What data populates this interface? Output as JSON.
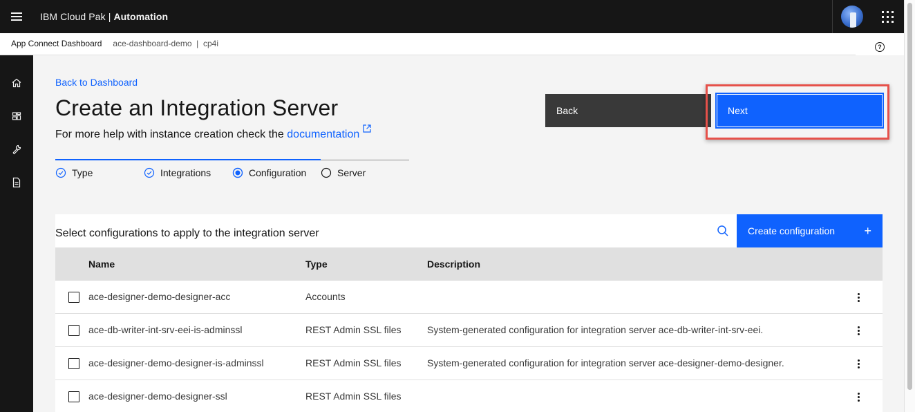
{
  "header": {
    "brand": "IBM Cloud Pak",
    "separator": "|",
    "product": "Automation"
  },
  "breadcrumb": {
    "app": "App Connect Dashboard",
    "instance": "ace-dashboard-demo",
    "divider": "|",
    "namespace": "cp4i"
  },
  "nav": {
    "items": [
      "home-icon",
      "dashboard-icon",
      "tools-icon",
      "document-icon"
    ]
  },
  "page": {
    "back_link": "Back to Dashboard",
    "title": "Create an Integration Server",
    "help_prefix": "For more help with instance creation check the ",
    "help_link": "documentation"
  },
  "actions": {
    "back_label": "Back",
    "next_label": "Next"
  },
  "progress": {
    "steps": [
      {
        "label": "Type",
        "state": "complete"
      },
      {
        "label": "Integrations",
        "state": "complete"
      },
      {
        "label": "Configuration",
        "state": "current"
      },
      {
        "label": "Server",
        "state": "incomplete"
      }
    ]
  },
  "table": {
    "title": "Select configurations to apply to the integration server",
    "create_label": "Create configuration",
    "create_icon": "+",
    "columns": [
      "Name",
      "Type",
      "Description"
    ],
    "rows": [
      {
        "name": "ace-designer-demo-designer-acc",
        "type": "Accounts",
        "description": ""
      },
      {
        "name": "ace-db-writer-int-srv-eei-is-adminssl",
        "type": "REST Admin SSL files",
        "description": "System-generated configuration for integration server ace-db-writer-int-srv-eei."
      },
      {
        "name": "ace-designer-demo-designer-is-adminssl",
        "type": "REST Admin SSL files",
        "description": "System-generated configuration for integration server ace-designer-demo-designer."
      },
      {
        "name": "ace-designer-demo-designer-ssl",
        "type": "REST Admin SSL files",
        "description": ""
      }
    ]
  },
  "colors": {
    "primary": "#0f62fe",
    "header_bg": "#161616",
    "highlight": "#e6514a"
  }
}
